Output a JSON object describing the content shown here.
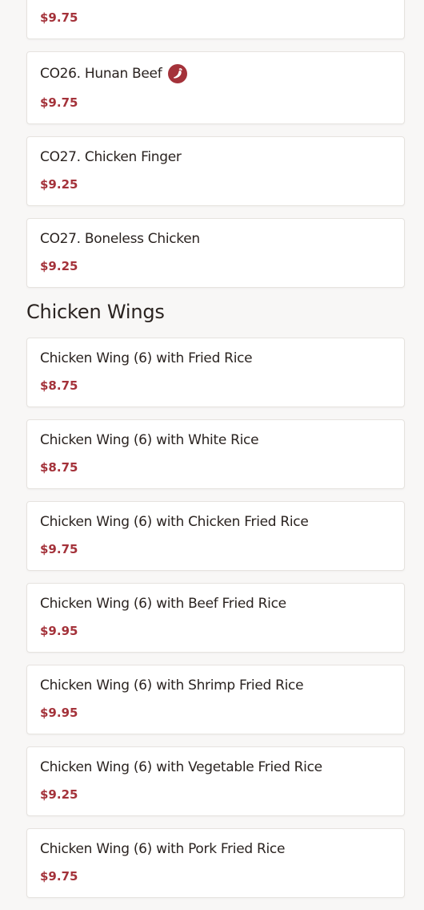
{
  "colors": {
    "price": "#a4323a",
    "text": "#2a2320",
    "spicy_icon": "#a4323a",
    "page_background": "#f8f7f6",
    "card_background": "#ffffff"
  },
  "top_items": [
    {
      "name": "",
      "price": "$9.75",
      "spicy": false
    },
    {
      "name": "CO26. Hunan Beef",
      "price": "$9.75",
      "spicy": true,
      "icon": "spicy-pepper-icon"
    },
    {
      "name": "CO27. Chicken Finger",
      "price": "$9.25",
      "spicy": false
    },
    {
      "name": "CO27. Boneless Chicken",
      "price": "$9.25",
      "spicy": false
    }
  ],
  "section": {
    "title": "Chicken Wings",
    "items": [
      {
        "name": "Chicken Wing (6) with Fried Rice",
        "price": "$8.75"
      },
      {
        "name": "Chicken Wing (6) with White Rice",
        "price": "$8.75"
      },
      {
        "name": "Chicken Wing (6) with Chicken Fried Rice",
        "price": "$9.75"
      },
      {
        "name": "Chicken Wing (6) with Beef Fried Rice",
        "price": "$9.95"
      },
      {
        "name": "Chicken Wing (6) with Shrimp Fried Rice",
        "price": "$9.95"
      },
      {
        "name": "Chicken Wing (6) with Vegetable Fried Rice",
        "price": "$9.25"
      },
      {
        "name": "Chicken Wing (6) with Pork Fried Rice",
        "price": "$9.75"
      }
    ]
  }
}
